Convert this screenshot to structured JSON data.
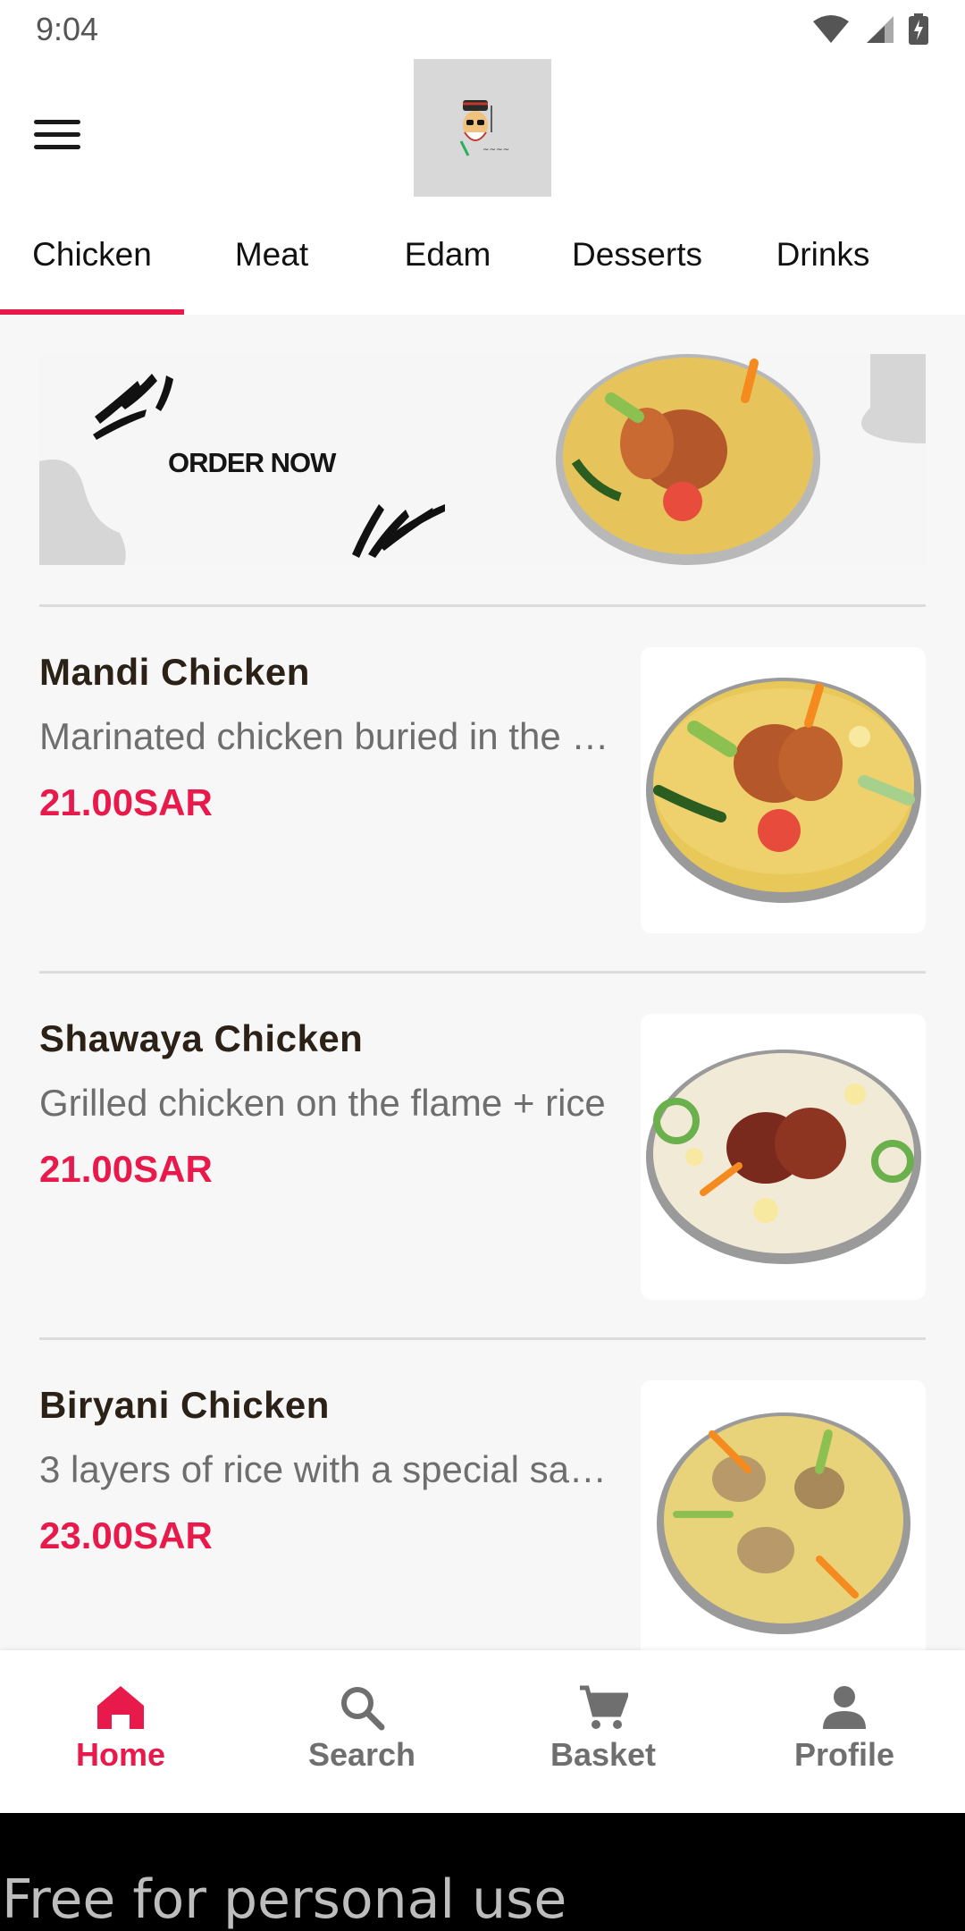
{
  "status_bar": {
    "time": "9:04"
  },
  "header": {
    "logo_icon": "restaurant-logo"
  },
  "tabs": [
    {
      "label": "Chicken",
      "active": true
    },
    {
      "label": "Meat",
      "active": false
    },
    {
      "label": "Edam",
      "active": false
    },
    {
      "label": "Desserts",
      "active": false
    },
    {
      "label": "Drinks",
      "active": false
    }
  ],
  "banner": {
    "text": "ORDER NOW"
  },
  "items": [
    {
      "name": "Mandi Chicken",
      "description": "Marinated chicken buried in the rice",
      "price": "21.00SAR"
    },
    {
      "name": "Shawaya Chicken",
      "description": "Grilled chicken on the flame + rice",
      "price": "21.00SAR"
    },
    {
      "name": "Biryani Chicken",
      "description": "3 layers of rice with a special sauce",
      "price": "23.00SAR"
    }
  ],
  "bottom_nav": [
    {
      "label": "Home",
      "icon": "home-icon",
      "active": true
    },
    {
      "label": "Search",
      "icon": "search-icon",
      "active": false
    },
    {
      "label": "Basket",
      "icon": "cart-icon",
      "active": false
    },
    {
      "label": "Profile",
      "icon": "profile-icon",
      "active": false
    }
  ],
  "watermark": "Free for personal use",
  "colors": {
    "accent": "#e8194b",
    "text_dark": "#2b2116",
    "text_muted": "#6e6e6e"
  }
}
